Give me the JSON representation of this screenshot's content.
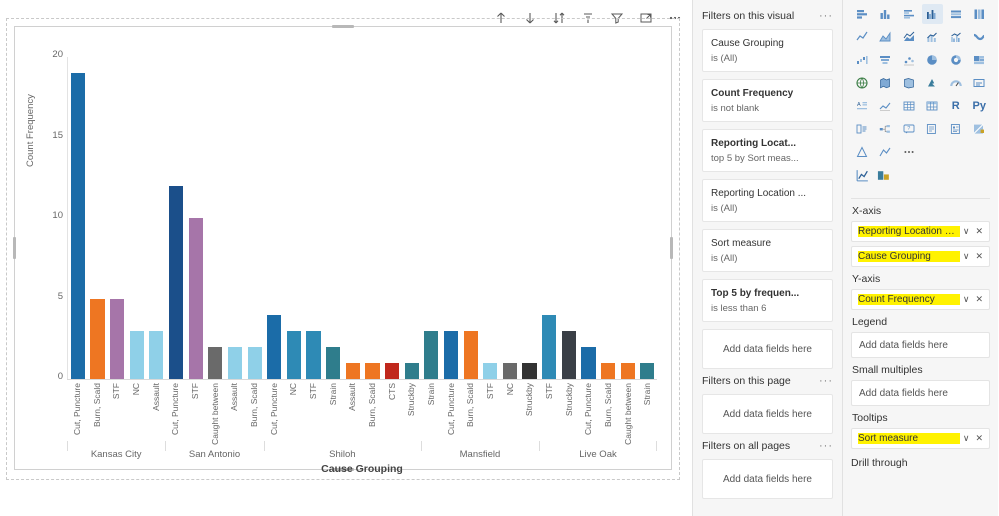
{
  "chart_data": {
    "type": "bar",
    "title": "",
    "xlabel": "Cause Grouping",
    "ylabel": "Count Frequency",
    "ylim": [
      0,
      20
    ],
    "yticks": [
      0,
      5,
      10,
      15,
      20
    ],
    "grid": false,
    "legend": "none",
    "groups": [
      {
        "name": "Kansas City",
        "categories": [
          "Cut, Puncture",
          "Burn, Scald",
          "STF",
          "NC",
          "Assault"
        ],
        "values": [
          19,
          5,
          5,
          3,
          3
        ],
        "colors": [
          "#1b6ca8",
          "#ee7622",
          "#a675a9",
          "#8fd0e8",
          "#8fd0e8"
        ]
      },
      {
        "name": "San Antonio",
        "categories": [
          "Cut, Puncture",
          "STF",
          "Caught between",
          "Assault",
          "Burn, Scald"
        ],
        "values": [
          12,
          10,
          2,
          2,
          2
        ],
        "colors": [
          "#1b4f8a",
          "#a675a9",
          "#6a6a6a",
          "#8fd0e8",
          "#8fd0e8"
        ]
      },
      {
        "name": "Shiloh",
        "categories": [
          "Cut, Puncture",
          "NC",
          "STF",
          "Strain",
          "Assault",
          "Burn, Scald",
          "CTS",
          "Struckby"
        ],
        "values": [
          4,
          3,
          3,
          2,
          1,
          1,
          1,
          1
        ],
        "colors": [
          "#1b6ca8",
          "#2e8ab5",
          "#2e8ab5",
          "#2f7d8c",
          "#ee7622",
          "#ee7622",
          "#c0281c",
          "#2f7d8c"
        ]
      },
      {
        "name": "Mansfield",
        "categories": [
          "Strain",
          "Cut, Puncture",
          "Burn, Scald",
          "STF",
          "NC",
          "Struckby"
        ],
        "values": [
          3,
          3,
          3,
          1,
          1,
          1
        ],
        "colors": [
          "#2f7d8c",
          "#1b6ca8",
          "#ee7622",
          "#8fd0e8",
          "#6a6a6a",
          "#333333"
        ]
      },
      {
        "name": "Live Oak",
        "categories": [
          "STF",
          "Struckby",
          "Cut, Puncture",
          "Burn, Scald",
          "Caught between",
          "Strain"
        ],
        "values": [
          4,
          3,
          2,
          1,
          1,
          1
        ],
        "colors": [
          "#2e8ab5",
          "#3a3f46",
          "#1b6ca8",
          "#ee7622",
          "#ee7622",
          "#2f7d8c"
        ]
      }
    ]
  },
  "toolbar": {
    "icons": [
      "sort-ascending-icon",
      "sort-descending-icon",
      "sort-order-icon",
      "drill-icon",
      "filter-icon",
      "focus-mode-icon",
      "more-options-icon"
    ]
  },
  "filters": {
    "visual": {
      "header": "Filters on this visual",
      "more": "···",
      "cards": [
        {
          "title": "Cause Grouping",
          "sub": "is (All)",
          "bold": false
        },
        {
          "title": "Count Frequency",
          "sub": "is not blank",
          "bold": true
        },
        {
          "title": "Reporting Locat...",
          "sub": "top 5 by Sort meas...",
          "bold": true
        },
        {
          "title": "Reporting Location ...",
          "sub": "is (All)",
          "bold": false
        },
        {
          "title": "Sort measure",
          "sub": "is (All)",
          "bold": false
        },
        {
          "title": "Top 5 by frequen...",
          "sub": "is less than 6",
          "bold": true
        }
      ],
      "dropzone": "Add data fields here"
    },
    "page": {
      "header": "Filters on this page",
      "more": "···",
      "dropzone": "Add data fields here"
    },
    "all_pages": {
      "header": "Filters on all pages",
      "more": "···",
      "dropzone": "Add data fields here"
    }
  },
  "viz": {
    "fields": [
      {
        "label": "X-axis",
        "wells": [
          {
            "name": "Reporting Location City",
            "highlight": true
          },
          {
            "name": "Cause Grouping",
            "highlight": true
          }
        ],
        "add": null
      },
      {
        "label": "Y-axis",
        "wells": [
          {
            "name": "Count Frequency",
            "highlight": true
          }
        ],
        "add": null
      },
      {
        "label": "Legend",
        "wells": [],
        "add": "Add data fields here"
      },
      {
        "label": "Small multiples",
        "wells": [],
        "add": "Add data fields here"
      },
      {
        "label": "Tooltips",
        "wells": [
          {
            "name": "Sort measure",
            "highlight": true
          }
        ],
        "add": null
      }
    ],
    "drill_through": "Drill through"
  }
}
